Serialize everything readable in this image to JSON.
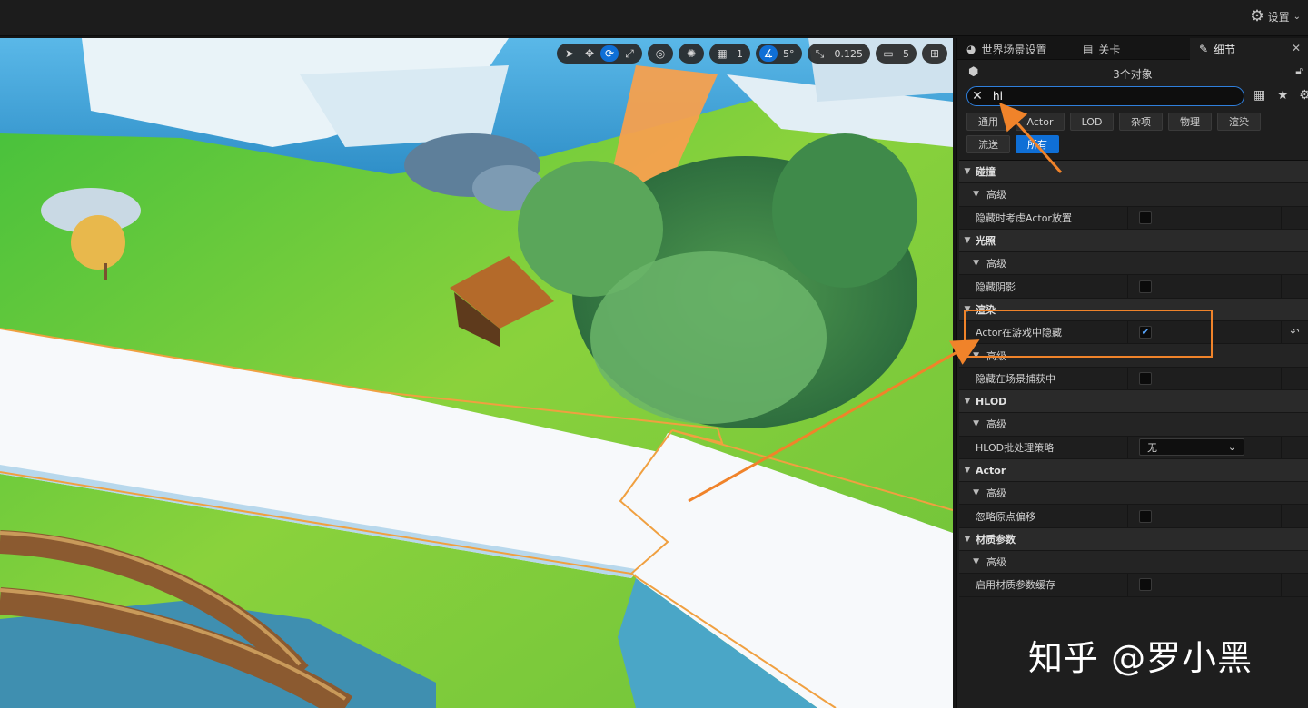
{
  "topbar": {
    "settings_label": "设置"
  },
  "viewport": {
    "toolbar": {
      "grid_value": "1",
      "angle_value": "5°",
      "scale_value": "0.125",
      "camera_value": "5"
    }
  },
  "panel": {
    "tabs": [
      {
        "label": "世界场景设置",
        "icon": "globe-icon"
      },
      {
        "label": "关卡",
        "icon": "level-icon"
      },
      {
        "label": "细节",
        "icon": "details-icon"
      }
    ],
    "object_count": "3个对象",
    "search": {
      "value": "hi",
      "placeholder": ""
    },
    "filters": [
      "通用",
      "Actor",
      "LOD",
      "杂项",
      "物理",
      "渲染",
      "流送",
      "所有"
    ],
    "active_filter": "所有",
    "sections": {
      "collision": {
        "title": "碰撞",
        "advanced": "高级",
        "prop": "隐藏时考虑Actor放置"
      },
      "lighting": {
        "title": "光照",
        "advanced": "高级",
        "prop": "隐藏阴影"
      },
      "rendering": {
        "title": "渲染",
        "prop1": "Actor在游戏中隐藏",
        "advanced": "高级",
        "prop2": "隐藏在场景捕获中"
      },
      "hlod": {
        "title": "HLOD",
        "advanced": "高级",
        "prop": "HLOD批处理策略",
        "dropdown_value": "无"
      },
      "actor": {
        "title": "Actor",
        "advanced": "高级",
        "prop": "忽略原点偏移"
      },
      "material": {
        "title": "材质参数",
        "advanced": "高级",
        "prop": "启用材质参数缓存"
      }
    }
  },
  "watermark": "知乎 @罗小黑",
  "colors": {
    "accent": "#0f6fd6",
    "annotation": "#f0832a"
  }
}
